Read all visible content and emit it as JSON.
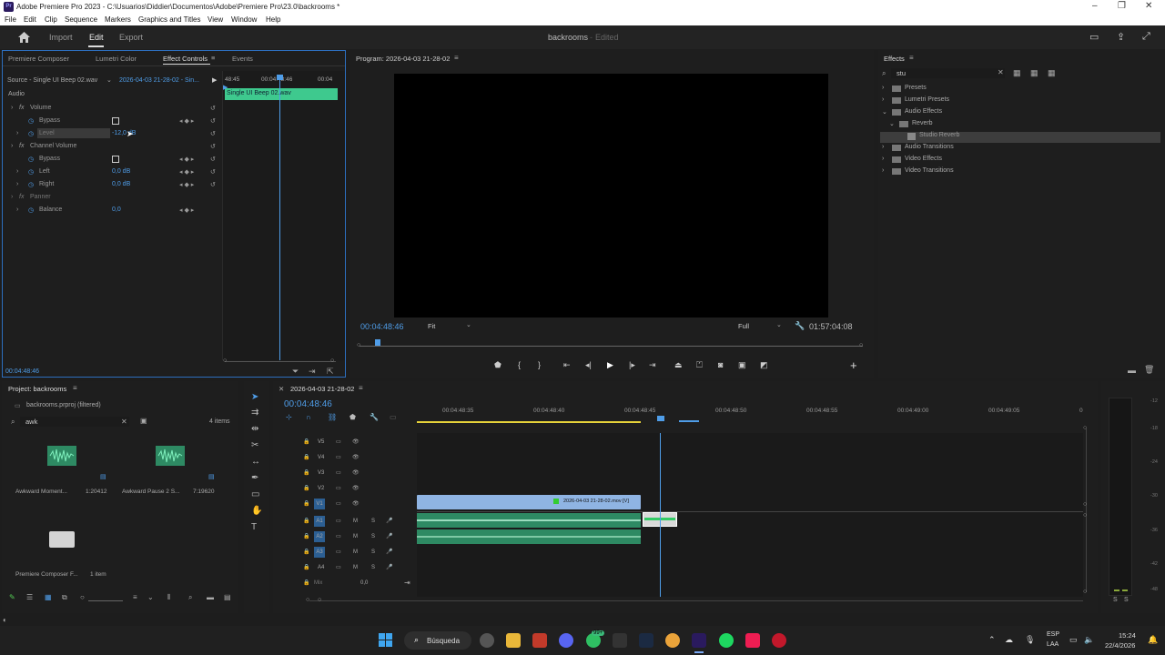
{
  "app": {
    "title": "Adobe Premiere Pro 2023 - C:\\Usuarios\\Diddier\\Documentos\\Adobe\\Premiere Pro\\23.0\\backrooms *",
    "logo": "Pr"
  },
  "menu": [
    "File",
    "Edit",
    "Clip",
    "Sequence",
    "Markers",
    "Graphics and Titles",
    "View",
    "Window",
    "Help"
  ],
  "workspace": {
    "tabs": [
      "Import",
      "Edit",
      "Export"
    ],
    "active": "Edit",
    "project": "backrooms",
    "status": "Edited"
  },
  "ec_panel": {
    "tabs": [
      "Premiere Composer",
      "Lumetri Color",
      "Effect Controls",
      "Events"
    ],
    "source": "Source - Single UI Beep 02.wav",
    "sequence": "2026-04-03 21-28-02 - Sin...",
    "mini_times": [
      "48:45",
      "00:04:48:46",
      "00:04"
    ],
    "clip_label": "Single UI Beep 02.wav",
    "section": "Audio",
    "rows": [
      {
        "label": "Volume",
        "value": ""
      },
      {
        "label": "Bypass",
        "value": ""
      },
      {
        "label": "Level",
        "value": "-12,0 dB"
      },
      {
        "label": "Channel Volume",
        "value": ""
      },
      {
        "label": "Bypass",
        "value": ""
      },
      {
        "label": "Left",
        "value": "0,0 dB"
      },
      {
        "label": "Right",
        "value": "0,0 dB"
      },
      {
        "label": "Panner",
        "value": ""
      },
      {
        "label": "Balance",
        "value": "0,0"
      }
    ],
    "timecode": "00:04:48:46"
  },
  "program": {
    "title": "Program: 2026-04-03 21-28-02",
    "timecode": "00:04:48:46",
    "fit": "Fit",
    "quality": "Full",
    "duration": "01:57:04:08"
  },
  "effects": {
    "title": "Effects",
    "search": "stu",
    "tree": [
      "Presets",
      "Lumetri Presets",
      "Audio Effects",
      "Reverb",
      "Studio Reverb",
      "Audio Transitions",
      "Video Effects",
      "Video Transitions"
    ]
  },
  "project": {
    "title": "Project: backrooms",
    "file": "backrooms.prproj (filtered)",
    "search": "awk",
    "count": "4 items",
    "items": [
      {
        "name": "Awkward Moment...",
        "dur": "1:20412"
      },
      {
        "name": "Awkward Pause 2 S...",
        "dur": "7:19620"
      },
      {
        "name": "Premiere Composer F...",
        "dur": "1 item"
      }
    ]
  },
  "timeline": {
    "tab": "2026-04-03 21-28-02",
    "timecode": "00:04:48:46",
    "ruler": [
      "00:04:48:35",
      "00:04:48:40",
      "00:04:48:45",
      "00:04:48:50",
      "00:04:48:55",
      "00:04:49:00",
      "00:04:49:05",
      "0"
    ],
    "video_tracks": [
      "V5",
      "V4",
      "V3",
      "V2",
      "V1"
    ],
    "audio_tracks": [
      "A1",
      "A2",
      "A3",
      "A4"
    ],
    "mix": "Mix",
    "mix_value": "0,0",
    "m": "M",
    "s": "S",
    "clip": "2026-04-03 21-28-02.mov [V]"
  },
  "meter": {
    "scale": [
      "-12",
      "-18",
      "-24",
      "-30",
      "-36",
      "-42",
      "-48"
    ],
    "buttons": [
      "S",
      "S"
    ]
  },
  "taskbar": {
    "search": "Búsqueda",
    "lang1": "ESP",
    "lang2": "LAA",
    "time": "15:24",
    "date": "22/4/2026",
    "badge": "99+"
  }
}
